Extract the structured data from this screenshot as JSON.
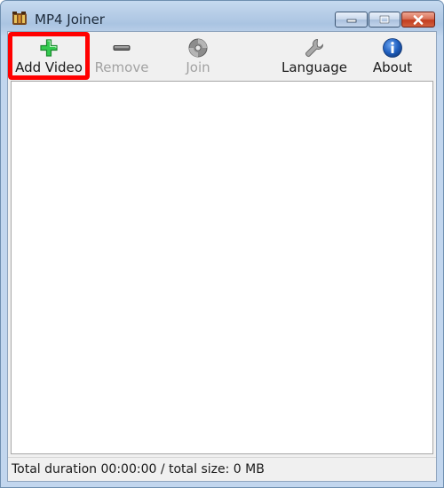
{
  "window": {
    "title": "MP4 Joiner"
  },
  "toolbar": {
    "add_video": "Add Video",
    "remove": "Remove",
    "join": "Join",
    "language": "Language",
    "about": "About"
  },
  "icons": {
    "app": "film-reel-icon",
    "add": "plus-icon",
    "remove": "minus-icon",
    "join": "disc-icon",
    "language": "wrench-icon",
    "about": "info-icon"
  },
  "colors": {
    "highlight": "#ff0000",
    "add_icon": "#22b14c",
    "about_icon": "#1f5fbf",
    "disabled_text": "#a2a2a2"
  },
  "status": {
    "text": "Total duration 00:00:00 / total size: 0 MB"
  }
}
